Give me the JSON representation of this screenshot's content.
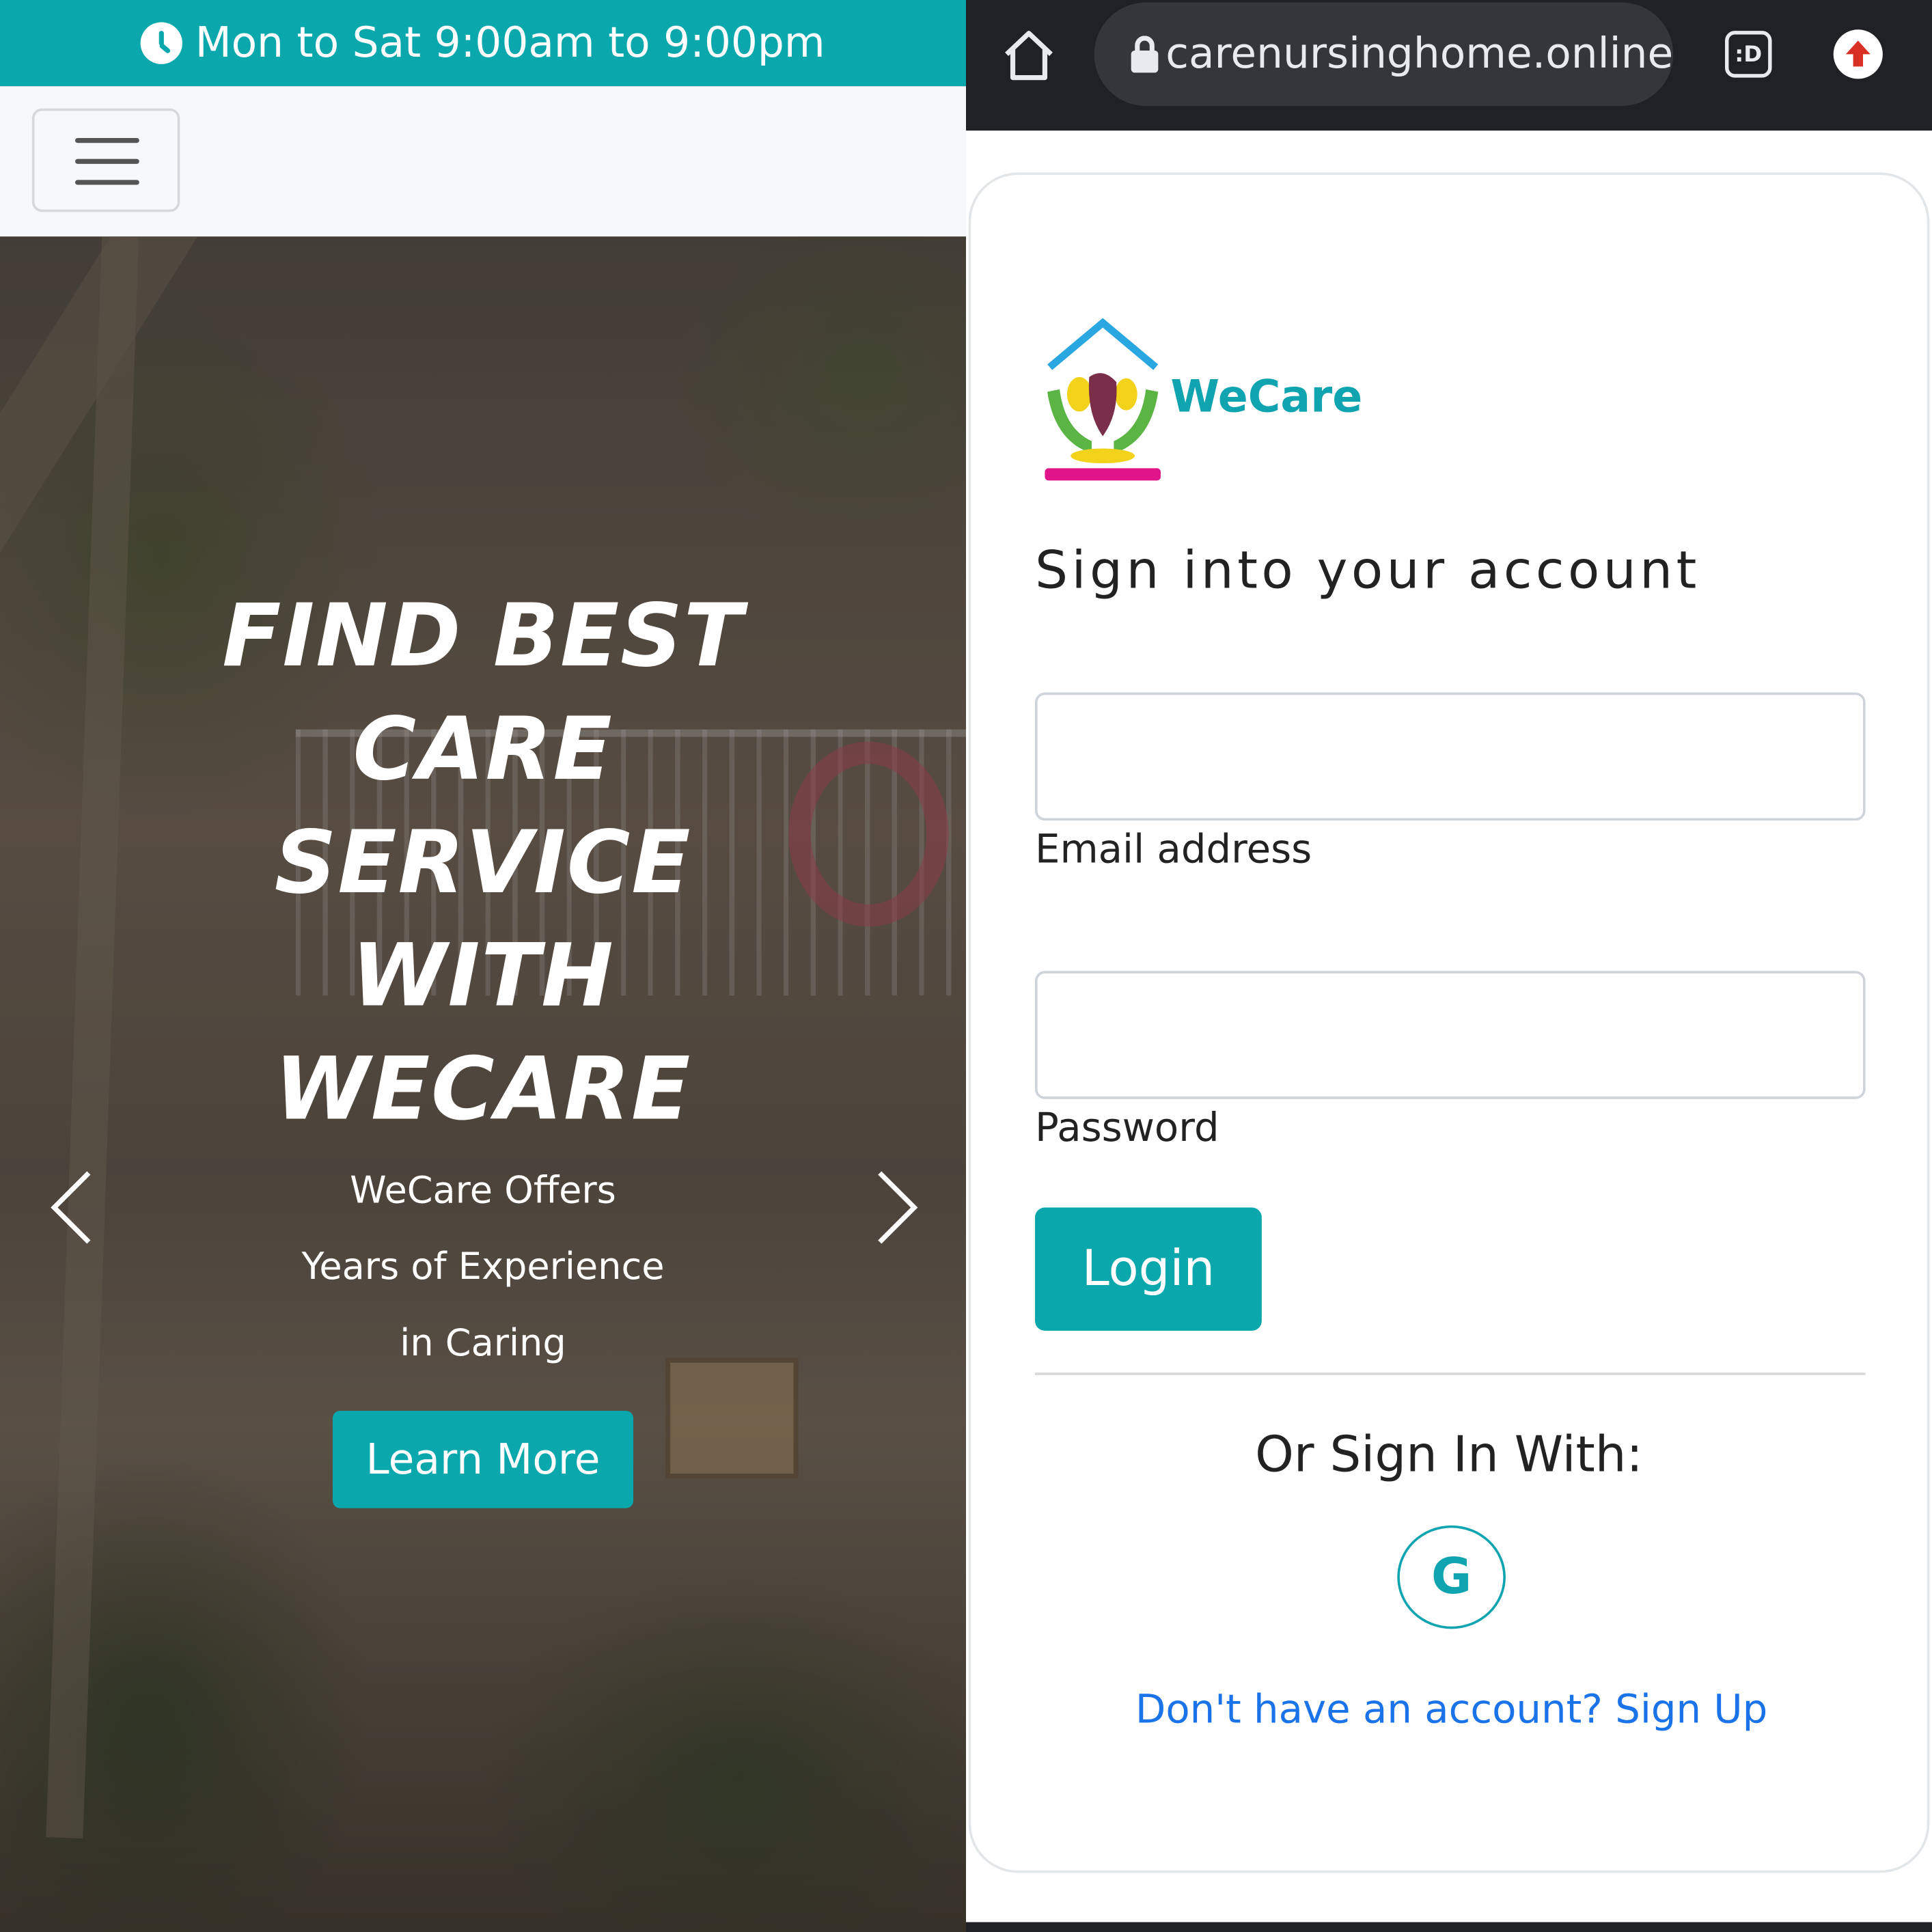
{
  "left": {
    "topbar": {
      "hours": "Mon to Sat 9:00am to 9:00pm"
    },
    "hero": {
      "title_lines": [
        "FIND BEST",
        "CARE",
        "SERVICE",
        "WITH",
        "WECARE"
      ],
      "subtitle_lines": [
        "WeCare Offers",
        "Years of Experience",
        "in Caring"
      ],
      "cta_label": "Learn More"
    }
  },
  "right": {
    "browser": {
      "url": "carenursinghome.online",
      "tab_icon_text": ":D"
    },
    "login": {
      "brand": "WeCare",
      "heading": "Sign into your account",
      "email_label": "Email address",
      "email_value": "",
      "password_label": "Password",
      "password_value": "",
      "login_label": "Login",
      "or_text": "Or Sign In With:",
      "google_letter": "G",
      "signup_text": "Don't have an account? Sign Up"
    }
  },
  "colors": {
    "accent": "#0aa8ad",
    "link": "#1a73e8",
    "browser_bar": "#202124"
  },
  "icons": [
    "clock-icon",
    "hamburger-icon",
    "chevron-left-icon",
    "chevron-right-icon",
    "home-icon",
    "lock-icon",
    "tab-switcher-icon",
    "update-icon",
    "google-icon"
  ]
}
